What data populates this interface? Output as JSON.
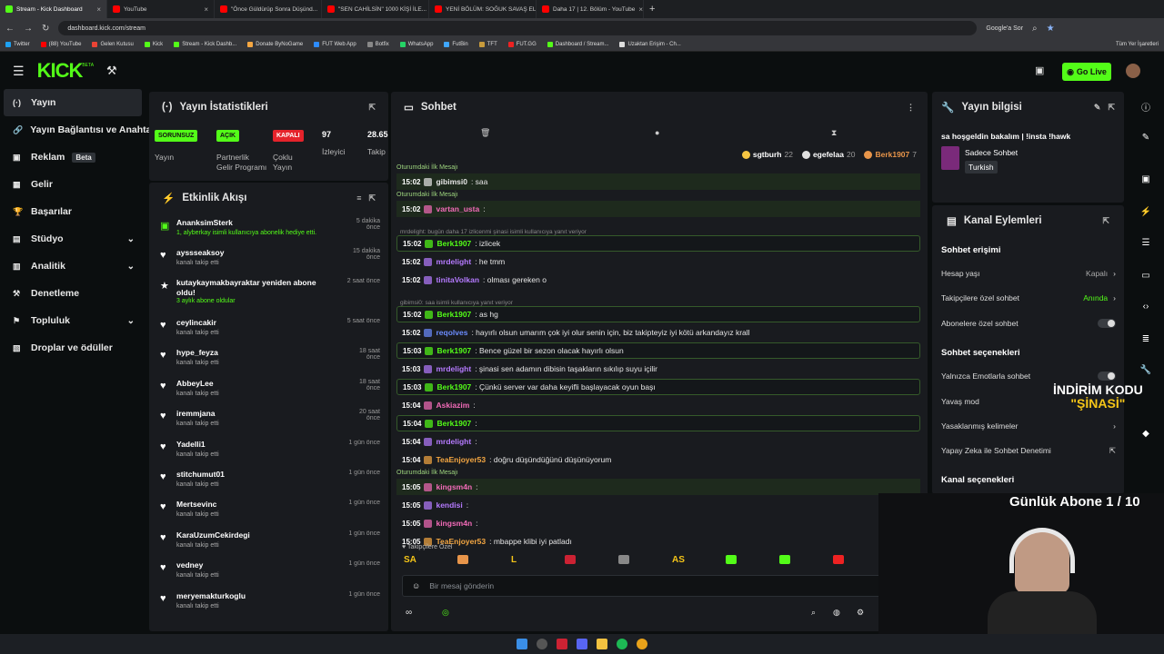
{
  "browser": {
    "tabs": [
      {
        "label": "Stream - Kick Dashboard",
        "color": "#53fc18"
      },
      {
        "label": "YouTube",
        "color": "#ff0000"
      },
      {
        "label": "\"Önce Güldürüp Sonra Düşünd...",
        "color": "#ff0000"
      },
      {
        "label": "\"SEN CAHİLSİN\" 1000 KİŞİ İLE...",
        "color": "#ff0000"
      },
      {
        "label": "YENİ BÖLÜM: SOĞUK SAVAŞ EL...",
        "color": "#ff0000"
      },
      {
        "label": "Daha 17 | 12. Bölüm - YouTube",
        "color": "#ff0000"
      }
    ],
    "url": "dashboard.kick.com/stream",
    "google_lens": "Google'a Sor",
    "bookmarks": [
      "Twitter",
      "(88) YouTube",
      "Gelen Kutusu",
      "Kick",
      "Stream - Kick Dashb...",
      "Donate ByNoGame",
      "FUT Web App",
      "Botfix",
      "WhatsApp",
      "FutBin",
      "TFT",
      "FUT.GG",
      "Dashboard / Stream...",
      "Uzaktan Erişim - Ch..."
    ],
    "all_bookmarks": "Tüm Yer İşaretleri"
  },
  "header": {
    "logo": "KICK",
    "beta": "BETA",
    "go_live": "Go Live"
  },
  "sidebar": {
    "items": [
      {
        "label": "Yayın",
        "icon": "broadcast-icon"
      },
      {
        "label": "Yayın Bağlantısı ve Anahtarı",
        "icon": "link-icon"
      },
      {
        "label": "Reklam",
        "icon": "ad-icon",
        "badge": "Beta"
      },
      {
        "label": "Gelir",
        "icon": "money-icon"
      },
      {
        "label": "Başarılar",
        "icon": "trophy-icon"
      },
      {
        "label": "Stüdyo",
        "icon": "studio-icon",
        "chevron": true
      },
      {
        "label": "Analitik",
        "icon": "chart-icon",
        "chevron": true
      },
      {
        "label": "Denetleme",
        "icon": "hammer-icon"
      },
      {
        "label": "Topluluk",
        "icon": "community-icon",
        "chevron": true
      },
      {
        "label": "Droplar ve ödüller",
        "icon": "gift-icon"
      }
    ]
  },
  "stats": {
    "title": "Yayın İstatistikleri",
    "status_badge": "SORUNSUZ",
    "status_label": "Yayın",
    "partner_badge": "AÇIK",
    "partner_label": "Partnerlik Gelir Programı",
    "multi_badge": "KAPALI",
    "multi_label": "Çoklu Yayın",
    "viewers": "97",
    "viewers_label": "İzleyici",
    "followers": "28.65",
    "followers_label": "Takip"
  },
  "activity": {
    "title": "Etkinlik Akışı",
    "items": [
      {
        "name": "AnanksimSterk",
        "sub": "1, alyberkay isimli kullanıcıya abonelik hediye etti.",
        "time": "5 dakika önce"
      },
      {
        "name": "ayssseaksoy",
        "sub": "kanalı takip etti",
        "time": "15 dakika önce"
      },
      {
        "name": "kutaykaymakbayraktar yeniden abone oldu!",
        "sub": "3 aylık abone oldular",
        "time": "2 saat önce"
      },
      {
        "name": "ceylincakir",
        "sub": "kanalı takip etti",
        "time": "5 saat önce"
      },
      {
        "name": "hype_feyza",
        "sub": "kanalı takip etti",
        "time": "18 saat önce"
      },
      {
        "name": "AbbeyLee",
        "sub": "kanalı takip etti",
        "time": "18 saat önce"
      },
      {
        "name": "iremmjana",
        "sub": "kanalı takip etti",
        "time": "20 saat önce"
      },
      {
        "name": "Yadelli1",
        "sub": "kanalı takip etti",
        "time": "1 gün önce"
      },
      {
        "name": "stitchumut01",
        "sub": "kanalı takip etti",
        "time": "1 gün önce"
      },
      {
        "name": "Mertsevinc",
        "sub": "kanalı takip etti",
        "time": "1 gün önce"
      },
      {
        "name": "KaraUzumCekirdegi",
        "sub": "kanalı takip etti",
        "time": "1 gün önce"
      },
      {
        "name": "vedney",
        "sub": "kanalı takip etti",
        "time": "1 gün önce"
      },
      {
        "name": "meryemakturkoglu",
        "sub": "kanalı takip etti",
        "time": "1 gün önce"
      }
    ]
  },
  "chat": {
    "title": "Sohbet",
    "top_chatters": [
      {
        "name": "sgtburh",
        "count": "22",
        "color": "#f5c542"
      },
      {
        "name": "egefelaa",
        "count": "20",
        "color": "#e0e0e0"
      },
      {
        "name": "Berk1907",
        "count": "7",
        "color": "#e8954a"
      }
    ],
    "first_msg_tag": "Oturumdaki İlk Mesajı",
    "messages": [
      {
        "time": "15:02",
        "user": "gibimsi0",
        "color": "#e6e6e6",
        "text": ": saa"
      },
      {
        "time": "15:02",
        "user": "vartan_usta",
        "color": "#f26bb8",
        "text": ":"
      },
      {
        "time": "15:02",
        "user": "Berk1907",
        "color": "#53fc18",
        "text": ": izlicek",
        "reply": "mrdelight: bugün daha 17 izlicenmi şinasi isimli kullanıcıya yanıt veriyor"
      },
      {
        "time": "15:02",
        "user": "mrdelight",
        "color": "#b57aff",
        "text": ": he tmm"
      },
      {
        "time": "15:02",
        "user": "tinitaVolkan",
        "color": "#b57aff",
        "text": ": olması gereken o"
      },
      {
        "time": "15:02",
        "user": "Berk1907",
        "color": "#53fc18",
        "text": ": as hg",
        "reply": "gibimsi0: saa isimli kullanıcıya yanıt veriyor"
      },
      {
        "time": "15:02",
        "user": "reqolves",
        "color": "#6c8cff",
        "text": ": hayırlı olsun umarım çok iyi olur senin için, biz takipteyiz iyi kötü arkandayız krall"
      },
      {
        "time": "15:03",
        "user": "Berk1907",
        "color": "#53fc18",
        "text": ": Bence güzel bir sezon olacak hayırlı olsun"
      },
      {
        "time": "15:03",
        "user": "mrdelight",
        "color": "#b57aff",
        "text": ": şinasi sen adamın dibisin taşakların sıkılıp suyu içilir"
      },
      {
        "time": "15:03",
        "user": "Berk1907",
        "color": "#53fc18",
        "text": ": Çünkü server var daha keyifli başlayacak oyun başı"
      },
      {
        "time": "15:04",
        "user": "Askiazim",
        "color": "#f26bb8",
        "text": ":"
      },
      {
        "time": "15:04",
        "user": "Berk1907",
        "color": "#53fc18",
        "text": ":"
      },
      {
        "time": "15:04",
        "user": "mrdelight",
        "color": "#b57aff",
        "text": ":"
      },
      {
        "time": "15:04",
        "user": "TeaEnjoyer53",
        "color": "#f5a742",
        "text": ": doğru düşündüğünü düşünüyorum"
      },
      {
        "time": "15:05",
        "user": "kingsm4n",
        "color": "#f26bb8",
        "text": ":"
      },
      {
        "time": "15:05",
        "user": "kendisi",
        "color": "#b57aff",
        "text": ":"
      },
      {
        "time": "15:05",
        "user": "kingsm4n",
        "color": "#f26bb8",
        "text": ":"
      },
      {
        "time": "15:05",
        "user": "TeaEnjoyer53",
        "color": "#f5a742",
        "text": ": mbappe klibi iyi patladı"
      }
    ],
    "follower_only": "Takipçilere Özel",
    "emotes": [
      "SA",
      "",
      "L",
      "",
      "",
      "AS",
      "",
      "",
      ""
    ],
    "input_placeholder": "Bir mesaj gönderin"
  },
  "stream_info": {
    "title": "Yayın bilgisi",
    "stream_title": "sa hoşgeldin bakalım | !insta !hawk",
    "category": "Sadece Sohbet",
    "language": "Turkish"
  },
  "channel_actions": {
    "title": "Kanal Eylemleri",
    "chat_access": "Sohbet erişimi",
    "account_age": "Hesap yaşı",
    "account_age_value": "Kapalı",
    "follower_chat": "Takipçilere özel sohbet",
    "follower_chat_value": "Anında",
    "sub_chat": "Abonelere özel sohbet",
    "chat_options": "Sohbet seçenekleri",
    "emote_only": "Yalnızca Emotlarla sohbet",
    "slow_mode": "Yavaş mod",
    "banned_words": "Yasaklanmış kelimeler",
    "ai_moderation": "Yapay Zeka ile Sohbet Denetimi",
    "channel_options": "Kanal seçenekleri"
  },
  "overlay": {
    "discount_line1": "İNDİRİM KODU",
    "discount_line2": "\"ŞİNASİ\"",
    "daily_subs": "Günlük Abone 1 / 10"
  }
}
